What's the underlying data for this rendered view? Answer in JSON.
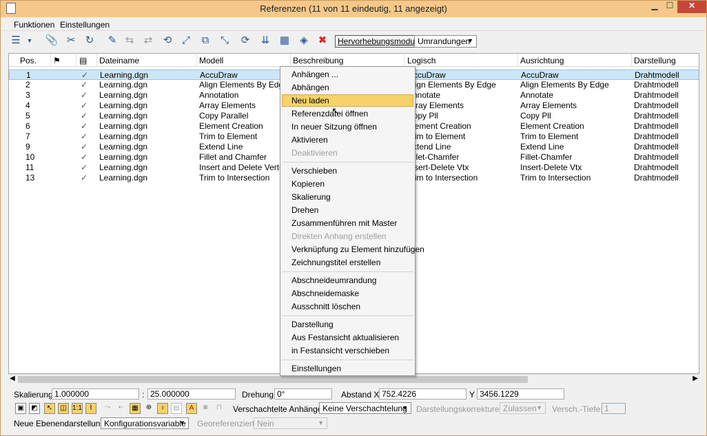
{
  "window": {
    "title": "Referenzen (11 von 11 eindeutig, 11 angezeigt)",
    "min": "▁",
    "max": "☐",
    "close": "✕"
  },
  "menu": {
    "funktionen": "Funktionen",
    "einstellungen": "Einstellungen"
  },
  "toolbar": {
    "highlight_mode": "Hervorhebungsmodus:",
    "mode_value": "Umrandungen"
  },
  "columns": [
    "Pos.",
    "Dateiname",
    "Modell",
    "Beschreibung",
    "Logisch",
    "Ausrichtung",
    "Darstellung"
  ],
  "rows": [
    {
      "pos": "1",
      "check": "✓",
      "file": "Learning.dgn",
      "model": "AccuDraw",
      "logical": "AccuDraw",
      "orient": "AccuDraw",
      "disp": "Drahtmodell"
    },
    {
      "pos": "2",
      "check": "✓",
      "file": "Learning.dgn",
      "model": "Align Elements By Edge",
      "logical": "Align Elements By Edge",
      "orient": "Align Elements By Edge",
      "disp": "Drahtmodell"
    },
    {
      "pos": "3",
      "check": "✓",
      "file": "Learning.dgn",
      "model": "Annotation",
      "logical": "Annotate",
      "orient": "Annotate",
      "disp": "Drahtmodell"
    },
    {
      "pos": "4",
      "check": "✓",
      "file": "Learning.dgn",
      "model": "Array Elements",
      "logical": "Array Elements",
      "orient": "Array Elements",
      "disp": "Drahtmodell"
    },
    {
      "pos": "5",
      "check": "✓",
      "file": "Learning.dgn",
      "model": "Copy Parallel",
      "logical": "Copy Pll",
      "orient": "Copy Pll",
      "disp": "Drahtmodell"
    },
    {
      "pos": "6",
      "check": "✓",
      "file": "Learning.dgn",
      "model": "Element Creation",
      "logical": "Element Creation",
      "orient": "Element Creation",
      "disp": "Drahtmodell"
    },
    {
      "pos": "7",
      "check": "✓",
      "file": "Learning.dgn",
      "model": "Trim to Element",
      "logical": "Trim to Element",
      "orient": "Trim to Element",
      "disp": "Drahtmodell"
    },
    {
      "pos": "9",
      "check": "✓",
      "file": "Learning.dgn",
      "model": "Extend Line",
      "logical": "Extend Line",
      "orient": "Extend Line",
      "disp": "Drahtmodell"
    },
    {
      "pos": "10",
      "check": "✓",
      "file": "Learning.dgn",
      "model": "Fillet and Chamfer",
      "logical": "Fillet-Chamfer",
      "orient": "Fillet-Chamfer",
      "disp": "Drahtmodell"
    },
    {
      "pos": "11",
      "check": "✓",
      "file": "Learning.dgn",
      "model": "Insert and Delete Vertex",
      "logical": "Insert-Delete Vtx",
      "orient": "Insert-Delete Vtx",
      "disp": "Drahtmodell"
    },
    {
      "pos": "13",
      "check": "✓",
      "file": "Learning.dgn",
      "model": "Trim to Intersection",
      "logical": "Trim to Intersection",
      "orient": "Trim to Intersection",
      "disp": "Drahtmodell"
    }
  ],
  "context_menu": [
    {
      "label": "Anhängen ...",
      "state": "normal"
    },
    {
      "label": "Abhängen",
      "state": "normal"
    },
    {
      "label": "Neu laden",
      "state": "highlighted"
    },
    {
      "label": "Referenzdatei öffnen",
      "state": "normal"
    },
    {
      "label": "In neuer Sitzung öffnen",
      "state": "normal"
    },
    {
      "label": "Aktivieren",
      "state": "normal"
    },
    {
      "label": "Deaktivieren",
      "state": "disabled"
    },
    {
      "label": "Verschieben",
      "state": "normal"
    },
    {
      "label": "Kopieren",
      "state": "normal"
    },
    {
      "label": "Skalierung",
      "state": "normal"
    },
    {
      "label": "Drehen",
      "state": "normal"
    },
    {
      "label": "Zusammenführen mit Master",
      "state": "normal"
    },
    {
      "label": "Direkten Anhang erstellen",
      "state": "disabled"
    },
    {
      "label": "Verknüpfung zu Element hinzufügen",
      "state": "normal"
    },
    {
      "label": "Zeichnungstitel erstellen",
      "state": "normal"
    },
    {
      "label": "Abschneideumrandung",
      "state": "normal"
    },
    {
      "label": "Abschneidemaske",
      "state": "normal"
    },
    {
      "label": "Ausschnitt löschen",
      "state": "normal"
    },
    {
      "label": "Darstellung",
      "state": "normal"
    },
    {
      "label": "Aus Festansicht aktualisieren",
      "state": "normal"
    },
    {
      "label": "in Festansicht verschieben",
      "state": "normal"
    },
    {
      "label": "Einstellungen",
      "state": "normal"
    }
  ],
  "bottom": {
    "scale_label": "Skalierung",
    "scale1": "1.000000",
    "colon": ":",
    "scale2": "25.000000",
    "rotation_label": "Drehung",
    "rotation": "0°",
    "offset_label": "Abstand X",
    "x": "752.4226",
    "y_label": "Y",
    "y": "3456.1229",
    "nested_label": "Verschachtelte Anhänge:",
    "nested_value": "Keine Verschachtelung",
    "corr_label": "Darstellungskorrekturen:",
    "corr_value": "Zulassen",
    "depth_label": "Versch.-Tiefe:",
    "depth_value": "1",
    "level_label": "Neue Ebenendarstellung:",
    "level_value": "Konfigurationsvariable",
    "geo_label": "Georeferenziert:",
    "geo_value": "Nein"
  }
}
